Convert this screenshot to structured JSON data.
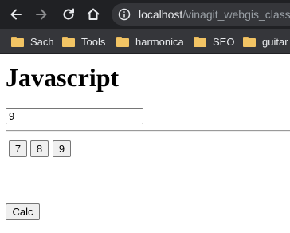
{
  "browser": {
    "url_host": "localhost",
    "url_path": "/vinagit_webgis_class/",
    "bookmarks": [
      {
        "label": "Sach"
      },
      {
        "label": "Tools"
      },
      {
        "label": "harmonica"
      },
      {
        "label": "SEO"
      },
      {
        "label": "guitar"
      }
    ],
    "icons": {
      "back": "back-arrow-icon",
      "forward": "forward-arrow-icon",
      "reload": "reload-icon",
      "home": "home-icon",
      "info": "info-icon",
      "folder": "folder-icon"
    }
  },
  "page": {
    "title": "Javascript",
    "input_value": "9",
    "digit_buttons": [
      "7",
      "8",
      "9"
    ],
    "calc_label": "Calc"
  },
  "colors": {
    "toolbar_bg": "#202124",
    "bookmarks_bg": "#35363a",
    "folder": "#f2c464"
  }
}
